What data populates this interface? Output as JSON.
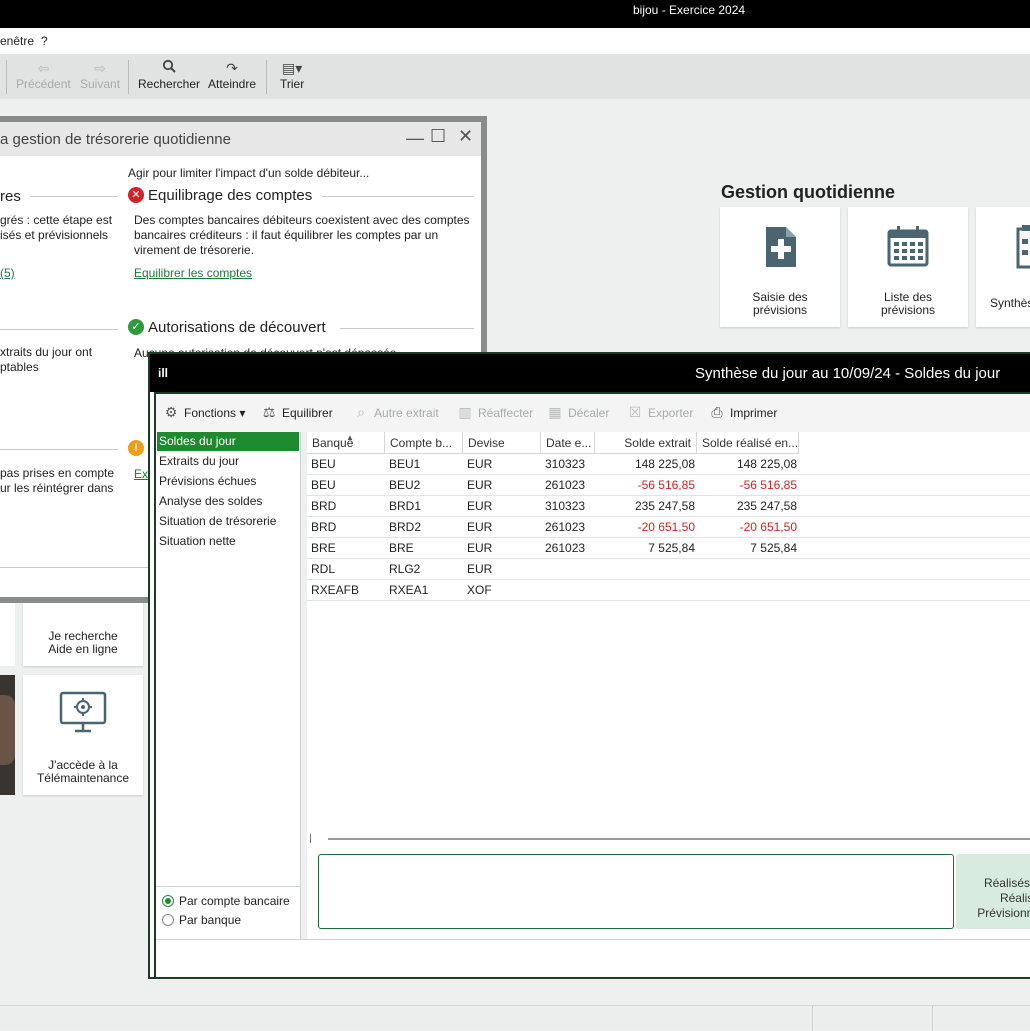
{
  "app": {
    "title": "bijou - Exercice 2024"
  },
  "menubar": {
    "items": [
      "enêtre",
      "?"
    ]
  },
  "toolbar": {
    "precedent": "Précédent",
    "suivant": "Suivant",
    "rechercher": "Rechercher",
    "atteindre": "Atteindre",
    "trier": "Trier"
  },
  "gestion_quotidienne": {
    "title": "Gestion quotidienne",
    "cards": [
      {
        "line1": "Saisie des",
        "line2": "prévisions",
        "icon": "document-plus-icon"
      },
      {
        "line1": "Liste des",
        "line2": "prévisions",
        "icon": "calendar-icon"
      },
      {
        "line1": "Synthès",
        "line2": "",
        "icon": "checklist-icon"
      }
    ]
  },
  "help_cards": [
    {
      "line1": "Je recherche",
      "line2": "Aide en ligne"
    },
    {
      "line1": "J'accède à la",
      "line2": "Télémaintenance"
    }
  ],
  "treso_dialog": {
    "title": "a gestion de trésorerie quotidienne",
    "left_heading": "res",
    "left_text1": "grés : cette étape est",
    "left_text2": "isés et prévisionnels",
    "left_link": "(5)",
    "left_text3": "xtraits du jour ont",
    "left_text4": "ptables",
    "left_text5": "pas prises en compte",
    "left_text6": "ur les réintégrer dans",
    "intro": "Agir pour limiter l'impact d'un solde débiteur...",
    "section1": {
      "title": "Equilibrage des comptes",
      "line1": "Des comptes bancaires débiteurs coexistent avec des comptes",
      "line2": "bancaires créditeurs : il faut équilibrer les comptes par un",
      "line3": "virement de trésorerie.",
      "link": "Equilibrer les comptes"
    },
    "section2": {
      "title": "Autorisations de découvert",
      "line1": "Aucune autorisation de découvert n'est dépassée."
    },
    "ext_link": "Ext"
  },
  "synthese": {
    "title": "Synthèse du jour au 10/09/24 - Soldes du jour",
    "app_icon": "ill",
    "toolbar": {
      "fonctions": "Fonctions",
      "equilibrer": "Equilibrer",
      "autre_extrait": "Autre extrait",
      "reaffecter": "Réaffecter",
      "decaler": "Décaler",
      "exporter": "Exporter",
      "imprimer": "Imprimer"
    },
    "nav": [
      "Soldes du jour",
      "Extraits du jour",
      "Prévisions échues",
      "Analyse des soldes",
      "Situation de trésorerie",
      "Situation nette"
    ],
    "radio": {
      "par_compte": "Par compte bancaire",
      "par_banque": "Par banque"
    },
    "columns": [
      "Banque",
      "Compte b...",
      "Devise",
      "Date e...",
      "Solde extrait",
      "Solde réalisé en..."
    ],
    "rows": [
      {
        "banque": "BEU",
        "compte": "BEU1",
        "devise": "EUR",
        "date": "310323",
        "solde_extrait": "148 225,08",
        "solde_realise": "148 225,08",
        "negative": false
      },
      {
        "banque": "BEU",
        "compte": "BEU2",
        "devise": "EUR",
        "date": "261023",
        "solde_extrait": "-56 516,85",
        "solde_realise": "-56 516,85",
        "negative": true
      },
      {
        "banque": "BRD",
        "compte": "BRD1",
        "devise": "EUR",
        "date": "310323",
        "solde_extrait": "235 247,58",
        "solde_realise": "235 247,58",
        "negative": false
      },
      {
        "banque": "BRD",
        "compte": "BRD2",
        "devise": "EUR",
        "date": "261023",
        "solde_extrait": "-20 651,50",
        "solde_realise": "-20 651,50",
        "negative": true
      },
      {
        "banque": "BRE",
        "compte": "BRE",
        "devise": "EUR",
        "date": "261023",
        "solde_extrait": "7 525,84",
        "solde_realise": "7 525,84",
        "negative": false
      },
      {
        "banque": "RDL",
        "compte": "RLG2",
        "devise": "EUR",
        "date": "",
        "solde_extrait": "",
        "solde_realise": "",
        "negative": false
      },
      {
        "banque": "RXEAFB",
        "compte": "RXEA1",
        "devise": "XOF",
        "date": "",
        "solde_extrait": "",
        "solde_realise": "",
        "negative": false
      }
    ],
    "legend": {
      "line1": "Réalisés e",
      "line2": "Réalisé",
      "line3": "Prévisionne"
    }
  },
  "colors": {
    "accent_green": "#1d8a2f",
    "negative_red": "#d21f1f",
    "titlebar_black": "#000000"
  }
}
